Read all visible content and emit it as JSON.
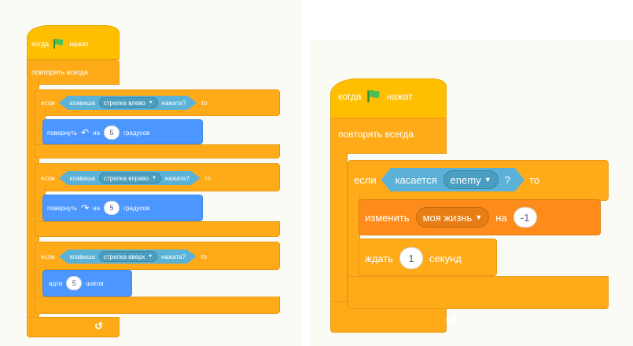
{
  "left_script": {
    "hat": {
      "when": "когда",
      "clicked": "нажат",
      "icon": "green-flag-icon"
    },
    "forever": "повторять всегда",
    "if_blocks": [
      {
        "if_label": "если",
        "key_label": "клавиша",
        "key": "стрелка влево",
        "pressed": "нажата?",
        "then": "то",
        "action": {
          "verb": "повернуть",
          "icon": "rotate-left-icon",
          "preposition": "на",
          "value": "5",
          "unit": "градусов"
        }
      },
      {
        "if_label": "если",
        "key_label": "клавиша",
        "key": "стрелка вправо",
        "pressed": "нажата?",
        "then": "то",
        "action": {
          "verb": "повернуть",
          "icon": "rotate-right-icon",
          "preposition": "на",
          "value": "5",
          "unit": "градусов"
        }
      },
      {
        "if_label": "если",
        "key_label": "клавиша",
        "key": "стрелка вверх",
        "pressed": "нажата?",
        "then": "то",
        "action": {
          "verb": "идти",
          "value": "5",
          "unit": "шагов"
        }
      }
    ],
    "loop_arrow": "↺"
  },
  "right_script": {
    "hat": {
      "when": "когда",
      "clicked": "нажат",
      "icon": "green-flag-icon"
    },
    "forever": "повторять всегда",
    "if_block": {
      "if_label": "если",
      "touching": "касается",
      "target": "enemy",
      "question": "?",
      "then": "то"
    },
    "change_block": {
      "verb": "изменить",
      "variable": "моя жизнь",
      "preposition": "на",
      "value": "-1"
    },
    "wait_block": {
      "verb": "ждать",
      "value": "1",
      "unit": "секунд"
    },
    "loop_arrow": "↺"
  },
  "colors": {
    "events": "#ffbf00",
    "control": "#ffab19",
    "motion": "#4c97ff",
    "variables": "#ff8c1a",
    "sensing": "#5cb1d6",
    "flag": "#4cbf56"
  }
}
